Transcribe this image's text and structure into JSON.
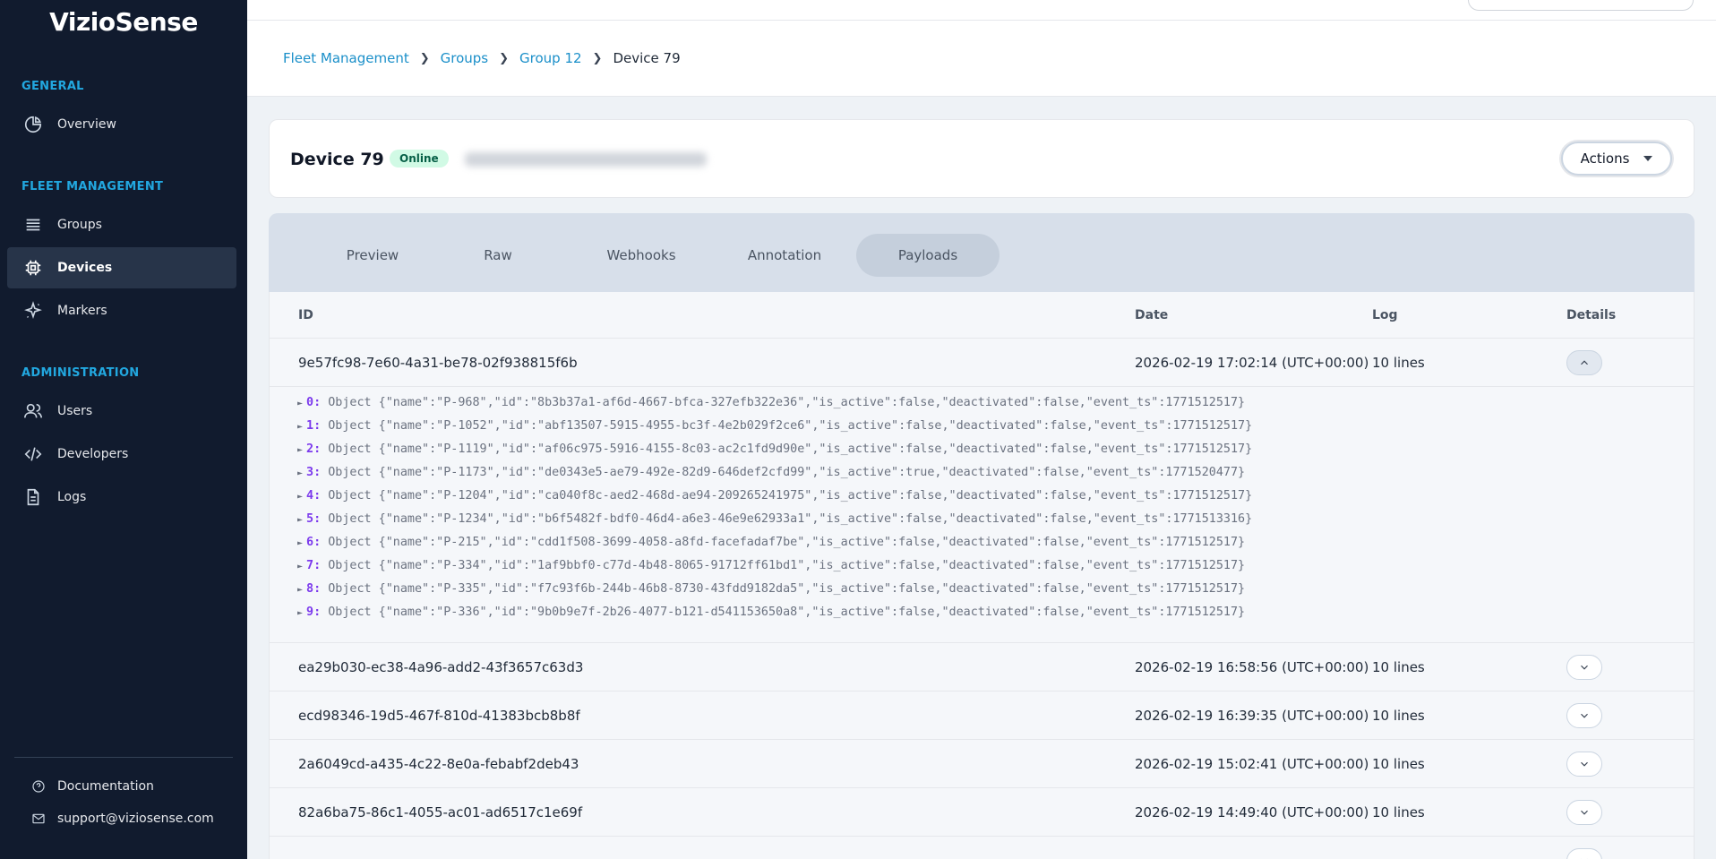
{
  "brand": {
    "logo_text": "VizioSense"
  },
  "sidebar": {
    "sections": [
      {
        "label": "GENERAL"
      },
      {
        "label": "FLEET MANAGEMENT"
      },
      {
        "label": "ADMINISTRATION"
      }
    ],
    "items": [
      {
        "label": "Overview",
        "icon": "pie-chart-icon"
      },
      {
        "label": "Groups",
        "icon": "list-icon"
      },
      {
        "label": "Devices",
        "icon": "chip-icon",
        "active": true
      },
      {
        "label": "Markers",
        "icon": "sparkle-icon"
      },
      {
        "label": "Users",
        "icon": "users-icon"
      },
      {
        "label": "Developers",
        "icon": "code-icon"
      },
      {
        "label": "Logs",
        "icon": "file-icon"
      }
    ],
    "footer": [
      {
        "label": "Documentation",
        "icon": "help-circle-icon"
      },
      {
        "label": "support@viziosense.com",
        "icon": "mail-icon"
      }
    ]
  },
  "breadcrumb": {
    "items": [
      "Fleet Management",
      "Groups",
      "Group 12"
    ],
    "current": "Device 79"
  },
  "device": {
    "title": "Device 79",
    "status": "Online",
    "actions_label": "Actions",
    "colors": {
      "status_bg": "#d1fae5",
      "status_text": "#065f46"
    }
  },
  "tabs": [
    {
      "label": "Preview"
    },
    {
      "label": "Raw"
    },
    {
      "label": "Webhooks"
    },
    {
      "label": "Annotation"
    },
    {
      "label": "Payloads",
      "active": true
    }
  ],
  "table": {
    "headers": {
      "id": "ID",
      "date": "Date",
      "log": "Log",
      "details": "Details"
    },
    "rows": [
      {
        "id": "9e57fc98-7e60-4a31-be78-02f938815f6b",
        "date": "2026-02-19 17:02:14 (UTC+00:00)",
        "log": "10 lines",
        "expanded": true
      },
      {
        "id": "ea29b030-ec38-4a96-add2-43f3657c63d3",
        "date": "2026-02-19 16:58:56 (UTC+00:00)",
        "log": "10 lines"
      },
      {
        "id": "ecd98346-19d5-467f-810d-41383bcb8b8f",
        "date": "2026-02-19 16:39:35 (UTC+00:00)",
        "log": "10 lines"
      },
      {
        "id": "2a6049cd-a435-4c22-8e0a-febabf2deb43",
        "date": "2026-02-19 15:02:41 (UTC+00:00)",
        "log": "10 lines"
      },
      {
        "id": "82a6ba75-86c1-4055-ac01-ad6517c1e69f",
        "date": "2026-02-19 14:49:40 (UTC+00:00)",
        "log": "10 lines"
      }
    ],
    "payload_lines": [
      {
        "index": "0:",
        "text": "Object {\"name\":\"P-968\",\"id\":\"8b3b37a1-af6d-4667-bfca-327efb322e36\",\"is_active\":false,\"deactivated\":false,\"event_ts\":1771512517}"
      },
      {
        "index": "1:",
        "text": "Object {\"name\":\"P-1052\",\"id\":\"abf13507-5915-4955-bc3f-4e2b029f2ce6\",\"is_active\":false,\"deactivated\":false,\"event_ts\":1771512517}"
      },
      {
        "index": "2:",
        "text": "Object {\"name\":\"P-1119\",\"id\":\"af06c975-5916-4155-8c03-ac2c1fd9d90e\",\"is_active\":false,\"deactivated\":false,\"event_ts\":1771512517}"
      },
      {
        "index": "3:",
        "text": "Object {\"name\":\"P-1173\",\"id\":\"de0343e5-ae79-492e-82d9-646def2cfd99\",\"is_active\":true,\"deactivated\":false,\"event_ts\":1771520477}"
      },
      {
        "index": "4:",
        "text": "Object {\"name\":\"P-1204\",\"id\":\"ca040f8c-aed2-468d-ae94-209265241975\",\"is_active\":false,\"deactivated\":false,\"event_ts\":1771512517}"
      },
      {
        "index": "5:",
        "text": "Object {\"name\":\"P-1234\",\"id\":\"b6f5482f-bdf0-46d4-a6e3-46e9e62933a1\",\"is_active\":false,\"deactivated\":false,\"event_ts\":1771513316}"
      },
      {
        "index": "6:",
        "text": "Object {\"name\":\"P-215\",\"id\":\"cdd1f508-3699-4058-a8fd-facefadaf7be\",\"is_active\":false,\"deactivated\":false,\"event_ts\":1771512517}"
      },
      {
        "index": "7:",
        "text": "Object {\"name\":\"P-334\",\"id\":\"1af9bbf0-c77d-4b48-8065-91712ff61bd1\",\"is_active\":false,\"deactivated\":false,\"event_ts\":1771512517}"
      },
      {
        "index": "8:",
        "text": "Object {\"name\":\"P-335\",\"id\":\"f7c93f6b-244b-46b8-8730-43fdd9182da5\",\"is_active\":false,\"deactivated\":false,\"event_ts\":1771512517}"
      },
      {
        "index": "9:",
        "text": "Object {\"name\":\"P-336\",\"id\":\"9b0b9e7f-2b26-4077-b121-d541153650a8\",\"is_active\":false,\"deactivated\":false,\"event_ts\":1771512517}"
      }
    ]
  },
  "colors": {
    "sidebar_bg": "#111b2e",
    "accent": "#22a8e0",
    "link": "#1a8fc9",
    "payload_index": "#7c3aed"
  }
}
